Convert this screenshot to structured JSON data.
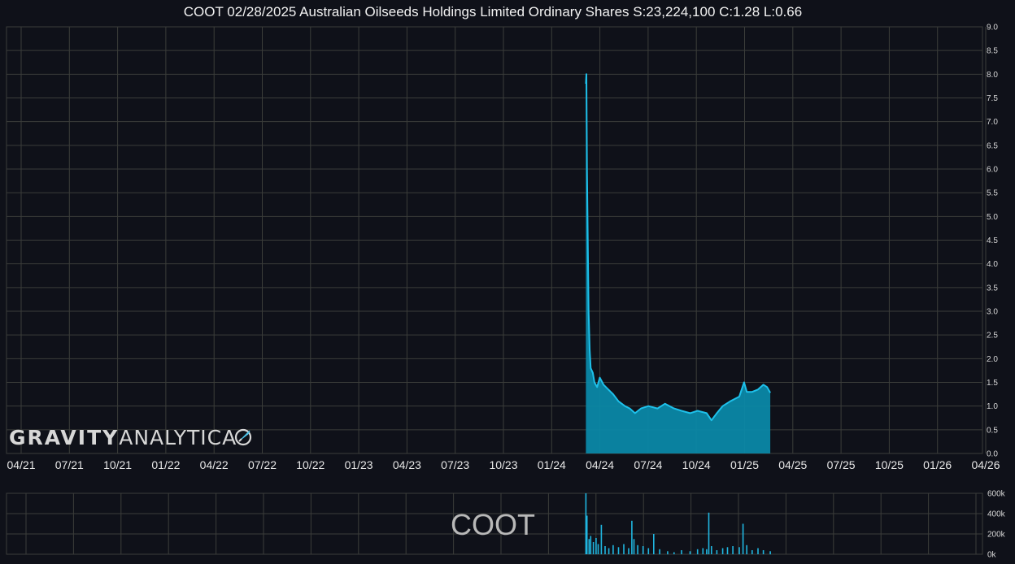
{
  "title": "COOT 02/28/2025 Australian Oilseeds Holdings Limited Ordinary Shares S:23,224,100 C:1.28 L:0.66",
  "watermark": {
    "bold": "GRAVITY",
    "light": "ANALYTICA"
  },
  "volume_label": "COOT",
  "colors": {
    "background": "#0f1119",
    "grid": "#3b3d3a",
    "price": "#1ec0ea",
    "fill": "#0b88a6",
    "volume": "#20b6e0"
  },
  "chart_data": [
    {
      "type": "area",
      "title": "COOT 02/28/2025 Australian Oilseeds Holdings Limited Ordinary Shares S:23,224,100 C:1.28 L:0.66",
      "xlabel": "",
      "ylabel": "",
      "x_ticks": [
        "04/21",
        "07/21",
        "10/21",
        "01/22",
        "04/22",
        "07/22",
        "10/22",
        "01/23",
        "04/23",
        "07/23",
        "10/23",
        "01/24",
        "04/24",
        "07/24",
        "10/24",
        "01/25",
        "04/25",
        "07/25",
        "10/25",
        "01/26",
        "04/26"
      ],
      "y_ticks": [
        "0.0",
        "0.5",
        "1.0",
        "1.5",
        "2.0",
        "2.5",
        "3.0",
        "3.5",
        "4.0",
        "4.5",
        "5.0",
        "5.5",
        "6.0",
        "6.5",
        "7.0",
        "7.5",
        "8.0",
        "8.5",
        "9.0"
      ],
      "xlim": [
        "2021-04-01",
        "2026-04-01"
      ],
      "ylim": [
        0,
        9
      ],
      "grid": true,
      "series": [
        {
          "values": [
            {
              "x": "2024-03-20",
              "y": 7.8
            },
            {
              "x": "2024-03-21",
              "y": 8.0
            },
            {
              "x": "2024-03-22",
              "y": 6.0
            },
            {
              "x": "2024-03-25",
              "y": 3.0
            },
            {
              "x": "2024-03-27",
              "y": 2.2
            },
            {
              "x": "2024-03-29",
              "y": 1.8
            },
            {
              "x": "2024-04-02",
              "y": 1.7
            },
            {
              "x": "2024-04-05",
              "y": 1.5
            },
            {
              "x": "2024-04-10",
              "y": 1.4
            },
            {
              "x": "2024-04-15",
              "y": 1.6
            },
            {
              "x": "2024-04-22",
              "y": 1.45
            },
            {
              "x": "2024-05-01",
              "y": 1.35
            },
            {
              "x": "2024-05-10",
              "y": 1.25
            },
            {
              "x": "2024-05-20",
              "y": 1.1
            },
            {
              "x": "2024-06-01",
              "y": 1.0
            },
            {
              "x": "2024-06-10",
              "y": 0.95
            },
            {
              "x": "2024-06-20",
              "y": 0.85
            },
            {
              "x": "2024-07-01",
              "y": 0.95
            },
            {
              "x": "2024-07-15",
              "y": 1.0
            },
            {
              "x": "2024-08-01",
              "y": 0.95
            },
            {
              "x": "2024-08-15",
              "y": 1.05
            },
            {
              "x": "2024-09-01",
              "y": 0.95
            },
            {
              "x": "2024-09-15",
              "y": 0.9
            },
            {
              "x": "2024-10-01",
              "y": 0.85
            },
            {
              "x": "2024-10-15",
              "y": 0.9
            },
            {
              "x": "2024-11-01",
              "y": 0.85
            },
            {
              "x": "2024-11-10",
              "y": 0.7
            },
            {
              "x": "2024-11-20",
              "y": 0.85
            },
            {
              "x": "2024-12-01",
              "y": 1.0
            },
            {
              "x": "2024-12-15",
              "y": 1.1
            },
            {
              "x": "2025-01-01",
              "y": 1.2
            },
            {
              "x": "2025-01-10",
              "y": 1.5
            },
            {
              "x": "2025-01-15",
              "y": 1.3
            },
            {
              "x": "2025-01-25",
              "y": 1.3
            },
            {
              "x": "2025-02-05",
              "y": 1.35
            },
            {
              "x": "2025-02-15",
              "y": 1.45
            },
            {
              "x": "2025-02-22",
              "y": 1.4
            },
            {
              "x": "2025-02-28",
              "y": 1.28
            }
          ]
        }
      ]
    },
    {
      "type": "bar",
      "xlabel": "",
      "ylabel": "",
      "y_ticks": [
        "0k",
        "200k",
        "400k",
        "600k"
      ],
      "ylim": [
        0,
        600000
      ],
      "grid": true,
      "series": [
        {
          "values": [
            {
              "x": "2024-03-20",
              "y": 600000
            },
            {
              "x": "2024-03-22",
              "y": 380000
            },
            {
              "x": "2024-03-26",
              "y": 150000
            },
            {
              "x": "2024-03-29",
              "y": 180000
            },
            {
              "x": "2024-04-03",
              "y": 120000
            },
            {
              "x": "2024-04-08",
              "y": 160000
            },
            {
              "x": "2024-04-12",
              "y": 100000
            },
            {
              "x": "2024-04-18",
              "y": 290000
            },
            {
              "x": "2024-04-25",
              "y": 80000
            },
            {
              "x": "2024-05-02",
              "y": 60000
            },
            {
              "x": "2024-05-10",
              "y": 90000
            },
            {
              "x": "2024-05-20",
              "y": 70000
            },
            {
              "x": "2024-05-30",
              "y": 100000
            },
            {
              "x": "2024-06-08",
              "y": 60000
            },
            {
              "x": "2024-06-14",
              "y": 330000
            },
            {
              "x": "2024-06-18",
              "y": 150000
            },
            {
              "x": "2024-06-25",
              "y": 90000
            },
            {
              "x": "2024-07-05",
              "y": 80000
            },
            {
              "x": "2024-07-15",
              "y": 60000
            },
            {
              "x": "2024-07-25",
              "y": 200000
            },
            {
              "x": "2024-08-05",
              "y": 50000
            },
            {
              "x": "2024-08-20",
              "y": 30000
            },
            {
              "x": "2024-09-01",
              "y": 20000
            },
            {
              "x": "2024-09-15",
              "y": 40000
            },
            {
              "x": "2024-10-01",
              "y": 30000
            },
            {
              "x": "2024-10-15",
              "y": 50000
            },
            {
              "x": "2024-10-25",
              "y": 60000
            },
            {
              "x": "2024-11-01",
              "y": 50000
            },
            {
              "x": "2024-11-05",
              "y": 410000
            },
            {
              "x": "2024-11-10",
              "y": 80000
            },
            {
              "x": "2024-11-20",
              "y": 40000
            },
            {
              "x": "2024-12-01",
              "y": 60000
            },
            {
              "x": "2024-12-10",
              "y": 70000
            },
            {
              "x": "2024-12-20",
              "y": 80000
            },
            {
              "x": "2025-01-01",
              "y": 70000
            },
            {
              "x": "2025-01-08",
              "y": 300000
            },
            {
              "x": "2025-01-15",
              "y": 90000
            },
            {
              "x": "2025-01-25",
              "y": 40000
            },
            {
              "x": "2025-02-05",
              "y": 60000
            },
            {
              "x": "2025-02-15",
              "y": 40000
            },
            {
              "x": "2025-02-28",
              "y": 30000
            }
          ]
        }
      ]
    }
  ]
}
